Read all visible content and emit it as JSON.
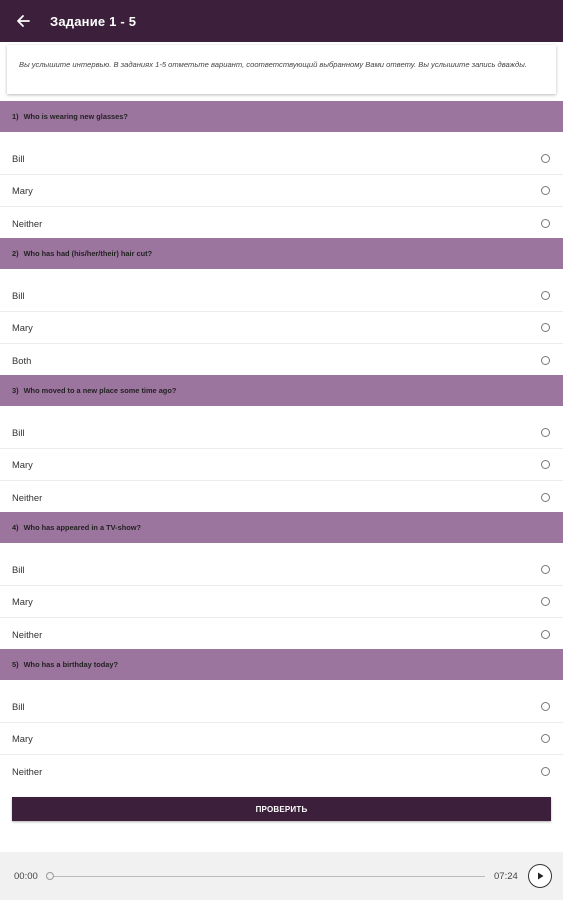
{
  "appbar": {
    "title": "Задание 1 - 5",
    "back_icon": "arrow-left-icon"
  },
  "instruction": "Вы услышите интервью. В заданиях 1-5 отметьте вариант, соответствующий выбранному Вами ответу. Вы услышите запись дважды.",
  "questions": [
    {
      "num": "1)",
      "text": "Who is wearing new glasses?",
      "options": [
        "Bill",
        "Mary",
        "Neither"
      ]
    },
    {
      "num": "2)",
      "text": "Who has had (his/her/their) hair cut?",
      "options": [
        "Bill",
        "Mary",
        "Both"
      ]
    },
    {
      "num": "3)",
      "text": "Who moved to a new place some time ago?",
      "options": [
        "Bill",
        "Mary",
        "Neither"
      ]
    },
    {
      "num": "4)",
      "text": "Who has appeared in a TV-show?",
      "options": [
        "Bill",
        "Mary",
        "Neither"
      ]
    },
    {
      "num": "5)",
      "text": "Who has a birthday today?",
      "options": [
        "Bill",
        "Mary",
        "Neither"
      ]
    }
  ],
  "check_button": "ПРОВЕРИТЬ",
  "player": {
    "current_time": "00:00",
    "duration": "07:24",
    "progress": 0,
    "play_icon": "play-icon"
  },
  "colors": {
    "appbar": "#3b1f3b",
    "question_header": "#9c759e",
    "button": "#3b1f3b"
  }
}
